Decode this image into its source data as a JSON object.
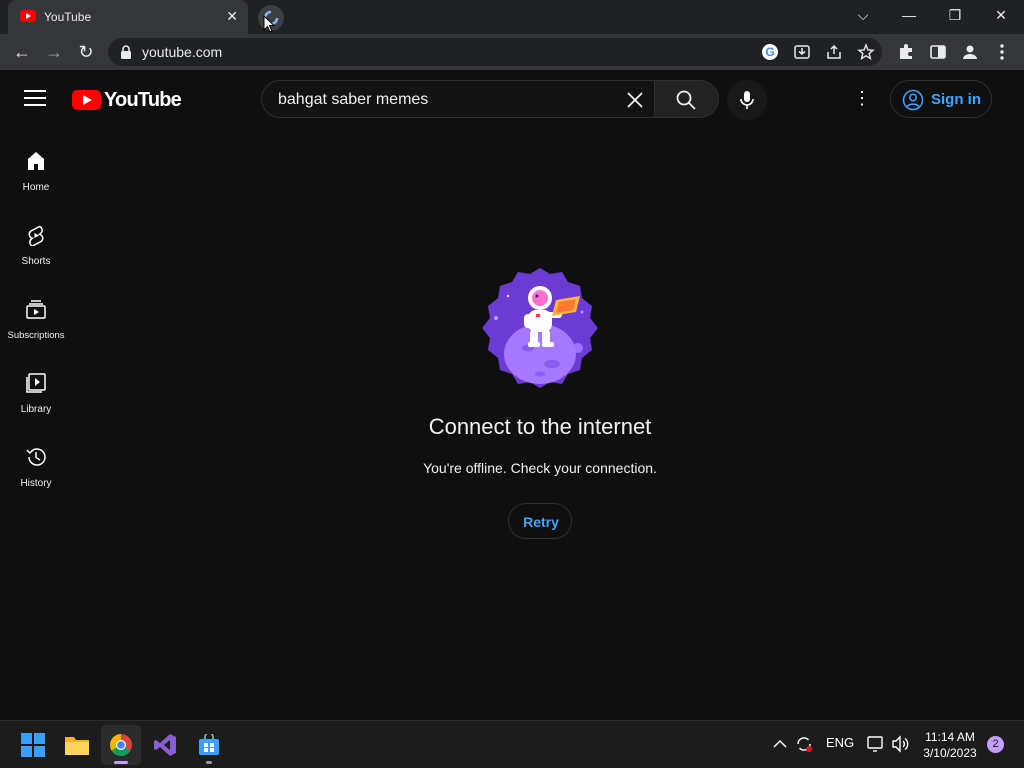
{
  "browser": {
    "tab": {
      "title": "YouTube",
      "close": "✕"
    },
    "window_controls": {
      "dropdown": "⌵",
      "minimize": "—",
      "restore": "❐",
      "close": "✕"
    },
    "nav": {
      "back": "←",
      "forward": "→",
      "reload": "↻"
    },
    "address": {
      "url": "youtube.com"
    }
  },
  "youtube": {
    "logo_text": "YouTube",
    "search": {
      "query": "bahgat saber memes"
    },
    "more": "⋮",
    "signin_label": "Sign in",
    "sidebar": [
      {
        "label": "Home",
        "icon": "home-icon"
      },
      {
        "label": "Shorts",
        "icon": "shorts-icon"
      },
      {
        "label": "Subscriptions",
        "icon": "subscriptions-icon"
      },
      {
        "label": "Library",
        "icon": "library-icon"
      },
      {
        "label": "History",
        "icon": "history-icon"
      }
    ],
    "offline": {
      "title": "Connect to the internet",
      "subtitle": "You're offline. Check your connection.",
      "retry": "Retry"
    }
  },
  "taskbar": {
    "language": "ENG",
    "time": "11:14 AM",
    "date": "3/10/2023",
    "notifications": "2"
  },
  "colors": {
    "accent": "#3ea6ff",
    "brand_red": "#ff0000",
    "background": "#0f0f0f"
  }
}
